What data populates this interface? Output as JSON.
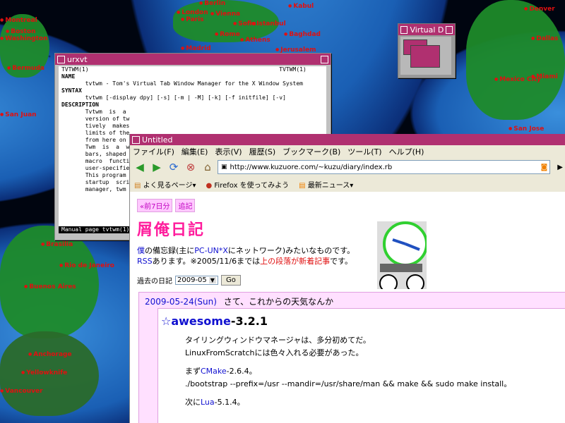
{
  "desktop": {
    "cities": [
      {
        "name": "Berlin"
      },
      {
        "name": "London"
      },
      {
        "name": "Vienna"
      },
      {
        "name": "Kabul"
      },
      {
        "name": "Paris"
      },
      {
        "name": "Sofia"
      },
      {
        "name": "Istanbul"
      },
      {
        "name": "Rome"
      },
      {
        "name": "Baghdad"
      },
      {
        "name": "Athens"
      },
      {
        "name": "Madrid"
      },
      {
        "name": "Jerusalem"
      },
      {
        "name": "Montreal"
      },
      {
        "name": "Boston"
      },
      {
        "name": "Washington"
      },
      {
        "name": "Bermuda"
      },
      {
        "name": "San Juan"
      },
      {
        "name": "Denver"
      },
      {
        "name": "Dallas"
      },
      {
        "name": "Miami"
      },
      {
        "name": "Mexico City"
      },
      {
        "name": "San Jose"
      },
      {
        "name": "Brasilia"
      },
      {
        "name": "Rio de Janeiro"
      },
      {
        "name": "Buenos Aires"
      },
      {
        "name": "Anchorage"
      },
      {
        "name": "Yellowknife"
      },
      {
        "name": "Vancouver"
      }
    ]
  },
  "urxvt": {
    "title": "urxvt",
    "lines": [
      "TVTWM(1)                                                        TVTWM(1)",
      "",
      "NAME",
      "       tvtwm - Tom's Virtual Tab Window Manager for the X Window System",
      "",
      "SYNTAX",
      "       tvtwm [-display dpy] [-s] [-m | -M] [-k] [-f initfile] [-v]",
      "",
      "DESCRIPTION",
      "       Tvtwm  is  a",
      "       version of tw",
      "       tively  makes",
      "       limits of the",
      "       from here on t",
      "",
      "       Twm  is  a  w",
      "       bars, shaped w",
      "       macro  functio",
      "       user-specified",
      "",
      "       This program i",
      "       startup  scrip",
      "       manager, twm i"
    ],
    "status": "Manual page tvtwm(1)"
  },
  "virtual_desktop": {
    "title": "Virtual Desktop"
  },
  "firefox": {
    "title": "Untitled",
    "menu": [
      "ファイル(F)",
      "編集(E)",
      "表示(V)",
      "履歴(S)",
      "ブックマーク(B)",
      "ツール(T)",
      "ヘルプ(H)"
    ],
    "url": "http://www.kuzuore.com/~kuzu/diary/index.rb",
    "bookmarks": [
      "よく見るページ▾",
      "Firefox を使ってみよう",
      "最新ニュース▾"
    ],
    "page": {
      "tabs": [
        "«前7日分",
        "追記"
      ],
      "title": "屑俺日記",
      "intro1_a": "僕",
      "intro1_b": "の備忘録(主に",
      "intro1_c": "PC-UN*X",
      "intro1_d": "にネットワーク)みたいなものです。",
      "intro2_a": "RSS",
      "intro2_b": "あります。※2005/11/6までは",
      "intro2_c": "上の段落が新着記事",
      "intro2_d": "です。",
      "past_label": "過去の日記",
      "past_value": "2009-05",
      "go": "Go",
      "entry_date": "2009-05-24(Sun)",
      "entry_title": "さて、これからの天気なんか",
      "section_title_a": "☆",
      "section_title_b": "awesome",
      "section_title_c": "-3.2.1",
      "para1": "タイリングウィンドウマネージャは、多分初めてだ。",
      "para2": "LinuxFromScratchには色々入れる必要があった。",
      "para3_a": "まず",
      "para3_b": "CMake",
      "para3_c": "-2.6.4。",
      "para4": "./bootstrap --prefix=/usr --mandir=/usr/share/man && make && sudo make install。",
      "para5_a": "次に",
      "para5_b": "Lua",
      "para5_c": "-5.1.4。"
    }
  }
}
